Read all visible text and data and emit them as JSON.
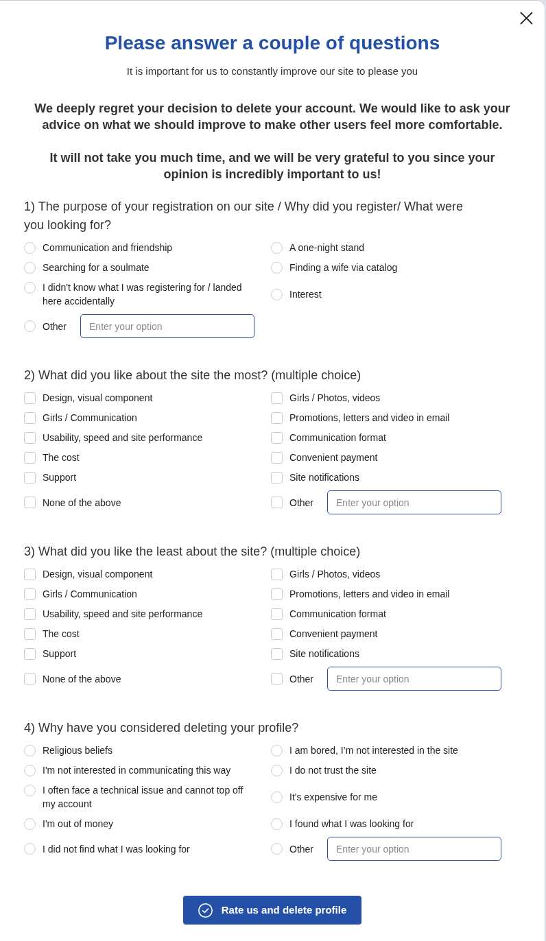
{
  "dialog": {
    "title": "Please answer a couple of questions",
    "subtitle": "It is important for us to constantly improve our site to please you",
    "paragraphs": [
      "We deeply regret your decision to delete your account. We would like to ask your advice on what we should improve to make other users feel more comfortable.",
      "It will not take you much time, and we will be very grateful to you since your opinion is incredibly important to us!"
    ]
  },
  "questions": [
    {
      "title": "1) The purpose of your registration on our site / Why did you register/ What were you looking for?",
      "kind": "single",
      "options": [
        {
          "kind": "option",
          "label": "Communication and friendship",
          "selected": false
        },
        {
          "kind": "option",
          "label": "A one-night stand",
          "selected": false
        },
        {
          "kind": "option",
          "label": "Searching for a soulmate",
          "selected": false
        },
        {
          "kind": "option",
          "label": "Finding a wife via catalog",
          "selected": false
        },
        {
          "kind": "option",
          "label": "I didn't know what I was registering for / landed here accidentally",
          "selected": false
        },
        {
          "kind": "option",
          "label": "Interest",
          "selected": false
        },
        {
          "kind": "other",
          "label": "Other",
          "selected": false,
          "placeholder": "Enter your option"
        }
      ]
    },
    {
      "title": "2) What did you like about the site the most? (multiple choice)",
      "kind": "multiple",
      "options": [
        {
          "kind": "option",
          "label": "Design, visual component",
          "checked": false
        },
        {
          "kind": "option",
          "label": "Girls / Photos, videos",
          "checked": false
        },
        {
          "kind": "option",
          "label": "Girls / Communication",
          "checked": false
        },
        {
          "kind": "option",
          "label": "Promotions, letters and video in email",
          "checked": false
        },
        {
          "kind": "option",
          "label": "Usability, speed and site performance",
          "checked": false
        },
        {
          "kind": "option",
          "label": "Communication format",
          "checked": false
        },
        {
          "kind": "option",
          "label": "The cost",
          "checked": false
        },
        {
          "kind": "option",
          "label": "Convenient payment",
          "checked": false
        },
        {
          "kind": "option",
          "label": "Support",
          "checked": false
        },
        {
          "kind": "option",
          "label": "Site notifications",
          "checked": false
        },
        {
          "kind": "option",
          "label": "None of the above",
          "checked": false
        },
        {
          "kind": "other",
          "label": "Other",
          "checked": false,
          "placeholder": "Enter your option"
        }
      ]
    },
    {
      "title": "3) What did you like the least about the site? (multiple choice)",
      "kind": "multiple",
      "options": [
        {
          "kind": "option",
          "label": "Design, visual component",
          "checked": false
        },
        {
          "kind": "option",
          "label": "Girls / Photos, videos",
          "checked": false
        },
        {
          "kind": "option",
          "label": "Girls / Communication",
          "checked": false
        },
        {
          "kind": "option",
          "label": "Promotions, letters and video in email",
          "checked": false
        },
        {
          "kind": "option",
          "label": "Usability, speed and site performance",
          "checked": false
        },
        {
          "kind": "option",
          "label": "Communication format",
          "checked": false
        },
        {
          "kind": "option",
          "label": "The cost",
          "checked": false
        },
        {
          "kind": "option",
          "label": "Convenient payment",
          "checked": false
        },
        {
          "kind": "option",
          "label": "Support",
          "checked": false
        },
        {
          "kind": "option",
          "label": "Site notifications",
          "checked": false
        },
        {
          "kind": "option",
          "label": "None of the above",
          "checked": false
        },
        {
          "kind": "other",
          "label": "Other",
          "checked": false,
          "placeholder": "Enter your option"
        }
      ]
    },
    {
      "title": "4) Why have you considered deleting your profile?",
      "kind": "single",
      "options": [
        {
          "kind": "option",
          "label": "Religious beliefs",
          "selected": false
        },
        {
          "kind": "option",
          "label": "I am bored, I’m not interested in the site",
          "selected": false
        },
        {
          "kind": "option",
          "label": "I'm not interested in communicating this way",
          "selected": false
        },
        {
          "kind": "option",
          "label": "I do not trust the site",
          "selected": false
        },
        {
          "kind": "option",
          "label": "I often face a technical issue and cannot top off my account",
          "selected": false
        },
        {
          "kind": "option",
          "label": "It's expensive for me",
          "selected": false
        },
        {
          "kind": "option",
          "label": "I'm out of money",
          "selected": false
        },
        {
          "kind": "option",
          "label": "I found what I was looking for",
          "selected": false
        },
        {
          "kind": "option",
          "label": "I did not find what I was looking for",
          "selected": false
        },
        {
          "kind": "other",
          "label": "Other",
          "selected": false,
          "placeholder": "Enter your option"
        }
      ]
    }
  ],
  "submit_button": {
    "label": "Rate us and delete profile"
  }
}
